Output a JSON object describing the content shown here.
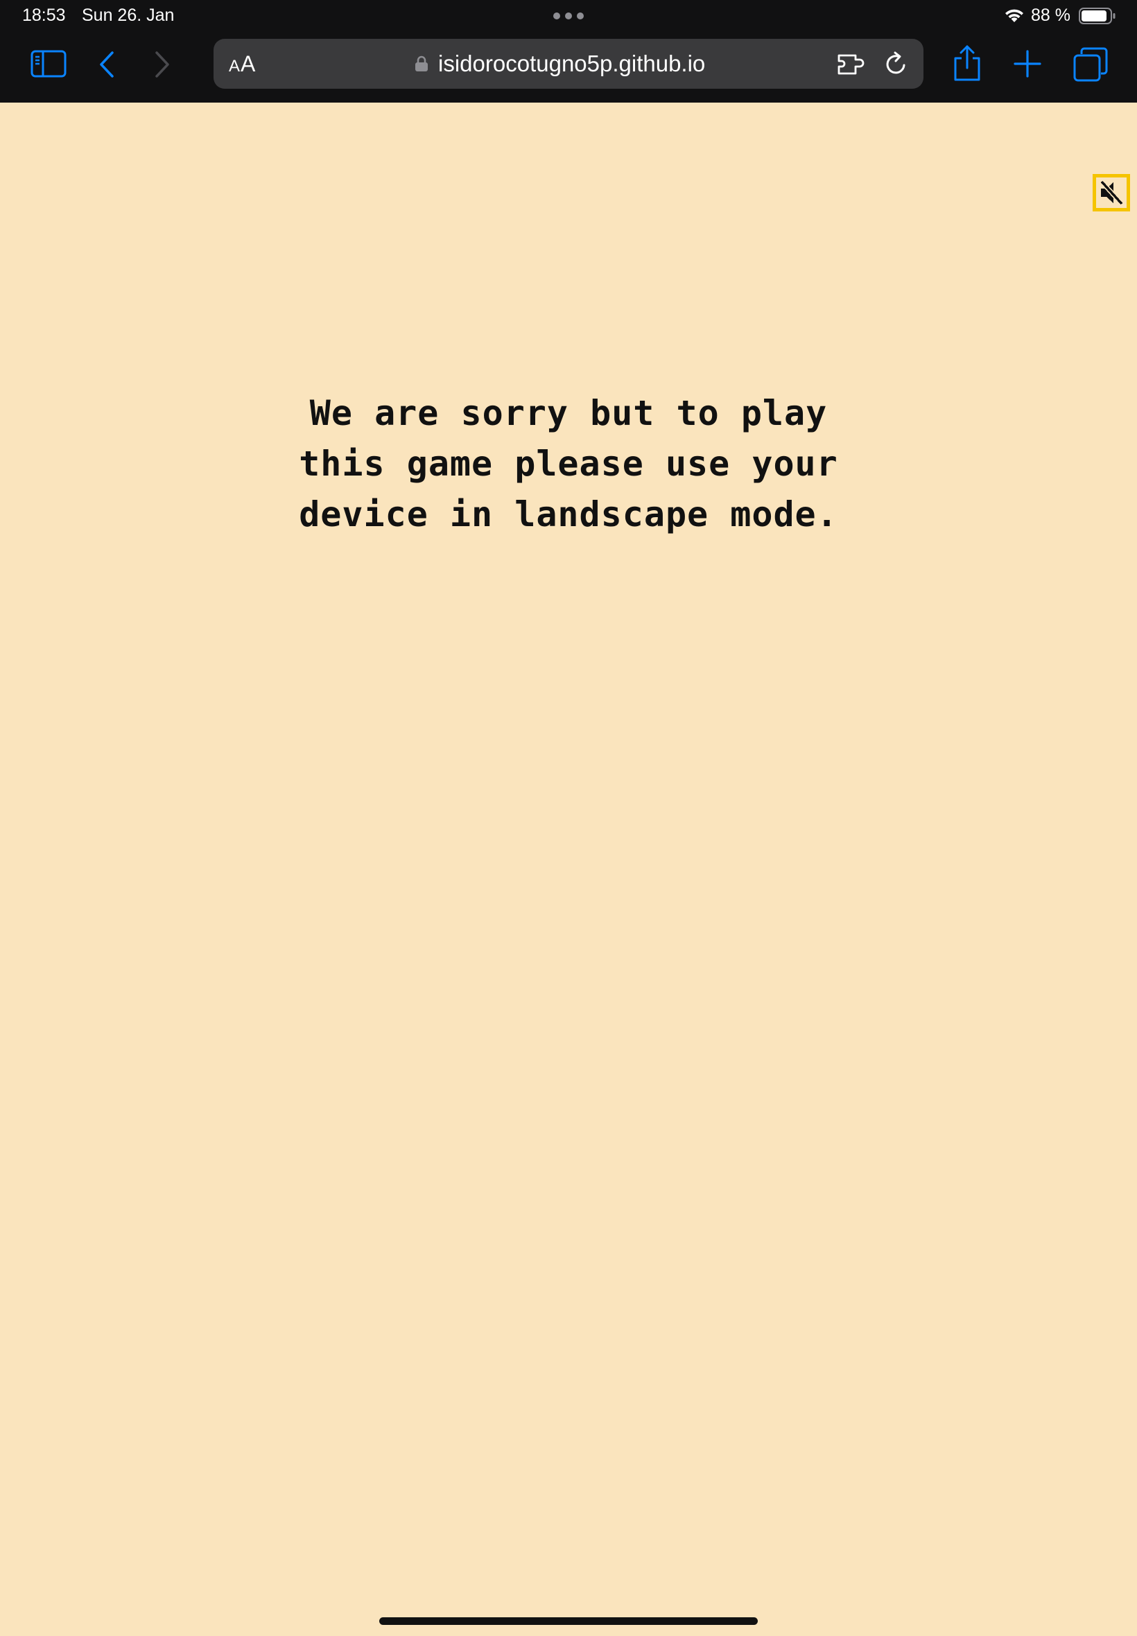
{
  "status_bar": {
    "time": "18:53",
    "date": "Sun 26. Jan",
    "battery_percent": "88 %",
    "battery_level": 0.88
  },
  "toolbar": {
    "sidebar_icon": "sidebar-icon",
    "back_icon": "chevron-left-icon",
    "forward_icon": "chevron-right-icon",
    "share_icon": "share-icon",
    "new_tab_icon": "plus-icon",
    "tabs_icon": "tabs-overview-icon"
  },
  "address_bar": {
    "aa_small": "A",
    "aa_large": "A",
    "url": "isidorocotugno5p.github.io"
  },
  "page": {
    "mute_icon": "speaker-muted-icon",
    "message": "We are sorry but to play this game please use your device in landscape mode."
  },
  "colors": {
    "page_background": "#fae4bd",
    "chrome_background": "#111112",
    "accent_blue": "#0a84ff",
    "mute_border": "#f5c400",
    "text": "#111111"
  }
}
